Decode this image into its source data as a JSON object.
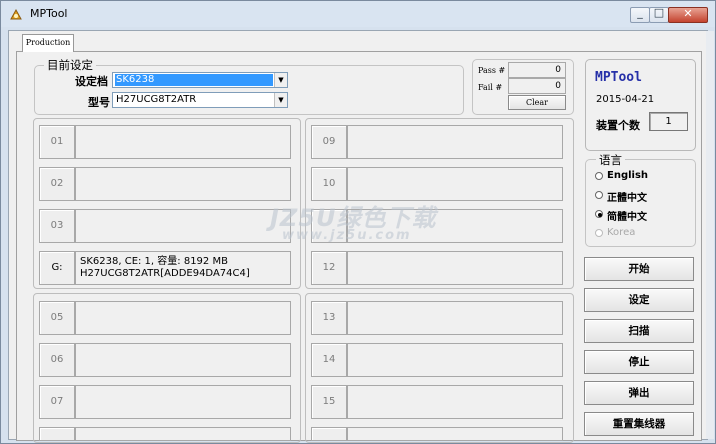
{
  "window": {
    "title": "MPTool"
  },
  "tabs": [
    {
      "label": "Production"
    }
  ],
  "settings": {
    "legend": "目前设定",
    "profile_label": "设定档",
    "profile_value": "SK6238",
    "model_label": "型号",
    "model_value": "H27UCG8T2ATR"
  },
  "stats": {
    "pass_label": "Pass #",
    "pass_value": "0",
    "fail_label": "Fail #",
    "fail_value": "0",
    "clear_label": "Clear"
  },
  "info": {
    "app_name": "MPTool",
    "date": "2015-04-21",
    "device_count_label": "装置个数",
    "device_count_value": "1"
  },
  "language": {
    "legend": "语言",
    "options": [
      {
        "label": "English",
        "selected": false,
        "enabled": true
      },
      {
        "label": "正體中文",
        "selected": false,
        "enabled": true
      },
      {
        "label": "简體中文",
        "selected": true,
        "enabled": true
      },
      {
        "label": "Korea",
        "selected": false,
        "enabled": false
      }
    ]
  },
  "actions": {
    "start": "开始",
    "settings": "设定",
    "scan": "扫描",
    "stop": "停止",
    "eject": "弹出",
    "reset_hub": "重置集线器"
  },
  "ports": {
    "p01": {
      "label": "01",
      "info_line1": "",
      "info_line2": ""
    },
    "p02": {
      "label": "02",
      "info_line1": "",
      "info_line2": ""
    },
    "p03": {
      "label": "03",
      "info_line1": "",
      "info_line2": ""
    },
    "pG": {
      "label": "G:",
      "info_line1": "SK6238, CE: 1, 容量: 8192 MB",
      "info_line2": "H27UCG8T2ATR[ADDE94DA74C4]"
    },
    "p05": {
      "label": "05",
      "info_line1": "",
      "info_line2": ""
    },
    "p06": {
      "label": "06",
      "info_line1": "",
      "info_line2": ""
    },
    "p07": {
      "label": "07",
      "info_line1": "",
      "info_line2": ""
    },
    "p09": {
      "label": "09",
      "info_line1": "",
      "info_line2": ""
    },
    "p10": {
      "label": "10",
      "info_line1": "",
      "info_line2": ""
    },
    "p11": {
      "label": "11",
      "info_line1": "",
      "info_line2": ""
    },
    "p12": {
      "label": "12",
      "info_line1": "",
      "info_line2": ""
    },
    "p13": {
      "label": "13",
      "info_line1": "",
      "info_line2": ""
    },
    "p14": {
      "label": "14",
      "info_line1": "",
      "info_line2": ""
    },
    "p15": {
      "label": "15",
      "info_line1": "",
      "info_line2": ""
    }
  },
  "watermark": {
    "line1": "JZ5U绿色下载",
    "line2": "www.jz5u.com"
  },
  "colors": {
    "accent_title": "#2630a8",
    "selection": "#3399ff",
    "close_button": "#c4432f"
  }
}
